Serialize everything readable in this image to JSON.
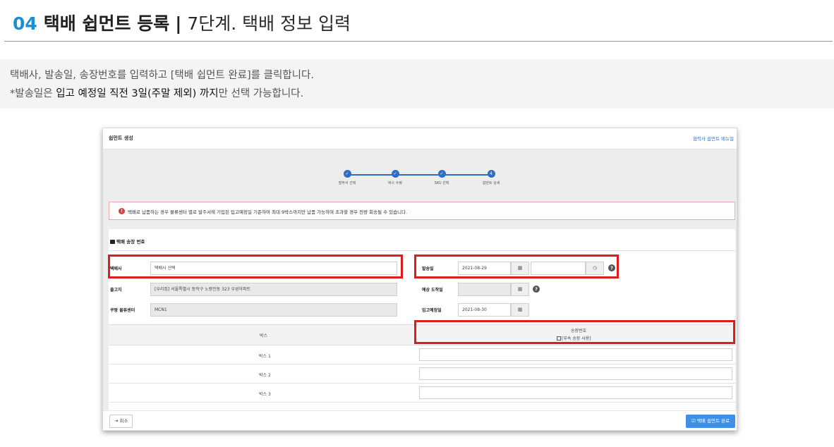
{
  "guide": {
    "number": "04",
    "title": "택배 쉽먼트 등록",
    "separator": "|",
    "step": "7단계. 택배 정보 입력",
    "desc1": "택배사, 발송일, 송장번호를 입력하고 [택배 쉽먼트 완료]를 클릭합니다.",
    "desc2_prefix": "*발송일은 ",
    "desc2_emph": "입고 예정일 직전 3일(주말 제외) 까지",
    "desc2_suffix": "만 선택 가능합니다."
  },
  "screen": {
    "title": "쉽먼트 생성",
    "manual_link": "협력사 쉽먼트 매뉴얼",
    "steps": [
      {
        "label": "발주서 선택",
        "icon": "check-icon",
        "mark": "✓"
      },
      {
        "label": "박스 수량",
        "icon": "check-icon",
        "mark": "✓"
      },
      {
        "label": "SKU 선택",
        "icon": "check-icon",
        "mark": "✓"
      },
      {
        "label": "쉽먼트 상세",
        "icon": "step-number-icon",
        "mark": "4"
      }
    ],
    "alert": {
      "icon": "exclamation-icon",
      "text": "택배로 납품하는 경우 물류센터 별로 발주서에 기입된 입고예정일 기준하여 최대 9박스까지만 납품 가능하며 초과할 경우 전량 회송될 수 있습니다."
    },
    "section_title": "택배 송장 번호",
    "carrier": {
      "label": "택배사",
      "value": "택배사 선택"
    },
    "origin": {
      "label": "출고지",
      "value": "[우리집] 서울특별시 동작구 노량진동 323 우성아파트"
    },
    "center": {
      "label": "쿠팡 물류센터",
      "value": "MCN1"
    },
    "ship_date": {
      "label": "발송일",
      "value": "2021-08-29",
      "time_value": ""
    },
    "arrival": {
      "label": "예상 도착일",
      "value": ""
    },
    "inbound": {
      "label": "입고예정일",
      "value": "2021-08-30"
    },
    "table": {
      "col_box": "박스",
      "col_invoice": "송장번호",
      "invoice_option": "[부속 송장 사용]",
      "rows": [
        {
          "box": "박스 1",
          "invoice": ""
        },
        {
          "box": "박스 2",
          "invoice": ""
        },
        {
          "box": "박스 3",
          "invoice": ""
        }
      ]
    },
    "cancel_label": "취소",
    "done_label": "택배 쉽먼트 완료",
    "colors": {
      "accent": "#2d6fc4",
      "highlight": "#e01b1b",
      "alert_border": "#f0a6a6",
      "primary_button": "#3d8fe8"
    }
  }
}
